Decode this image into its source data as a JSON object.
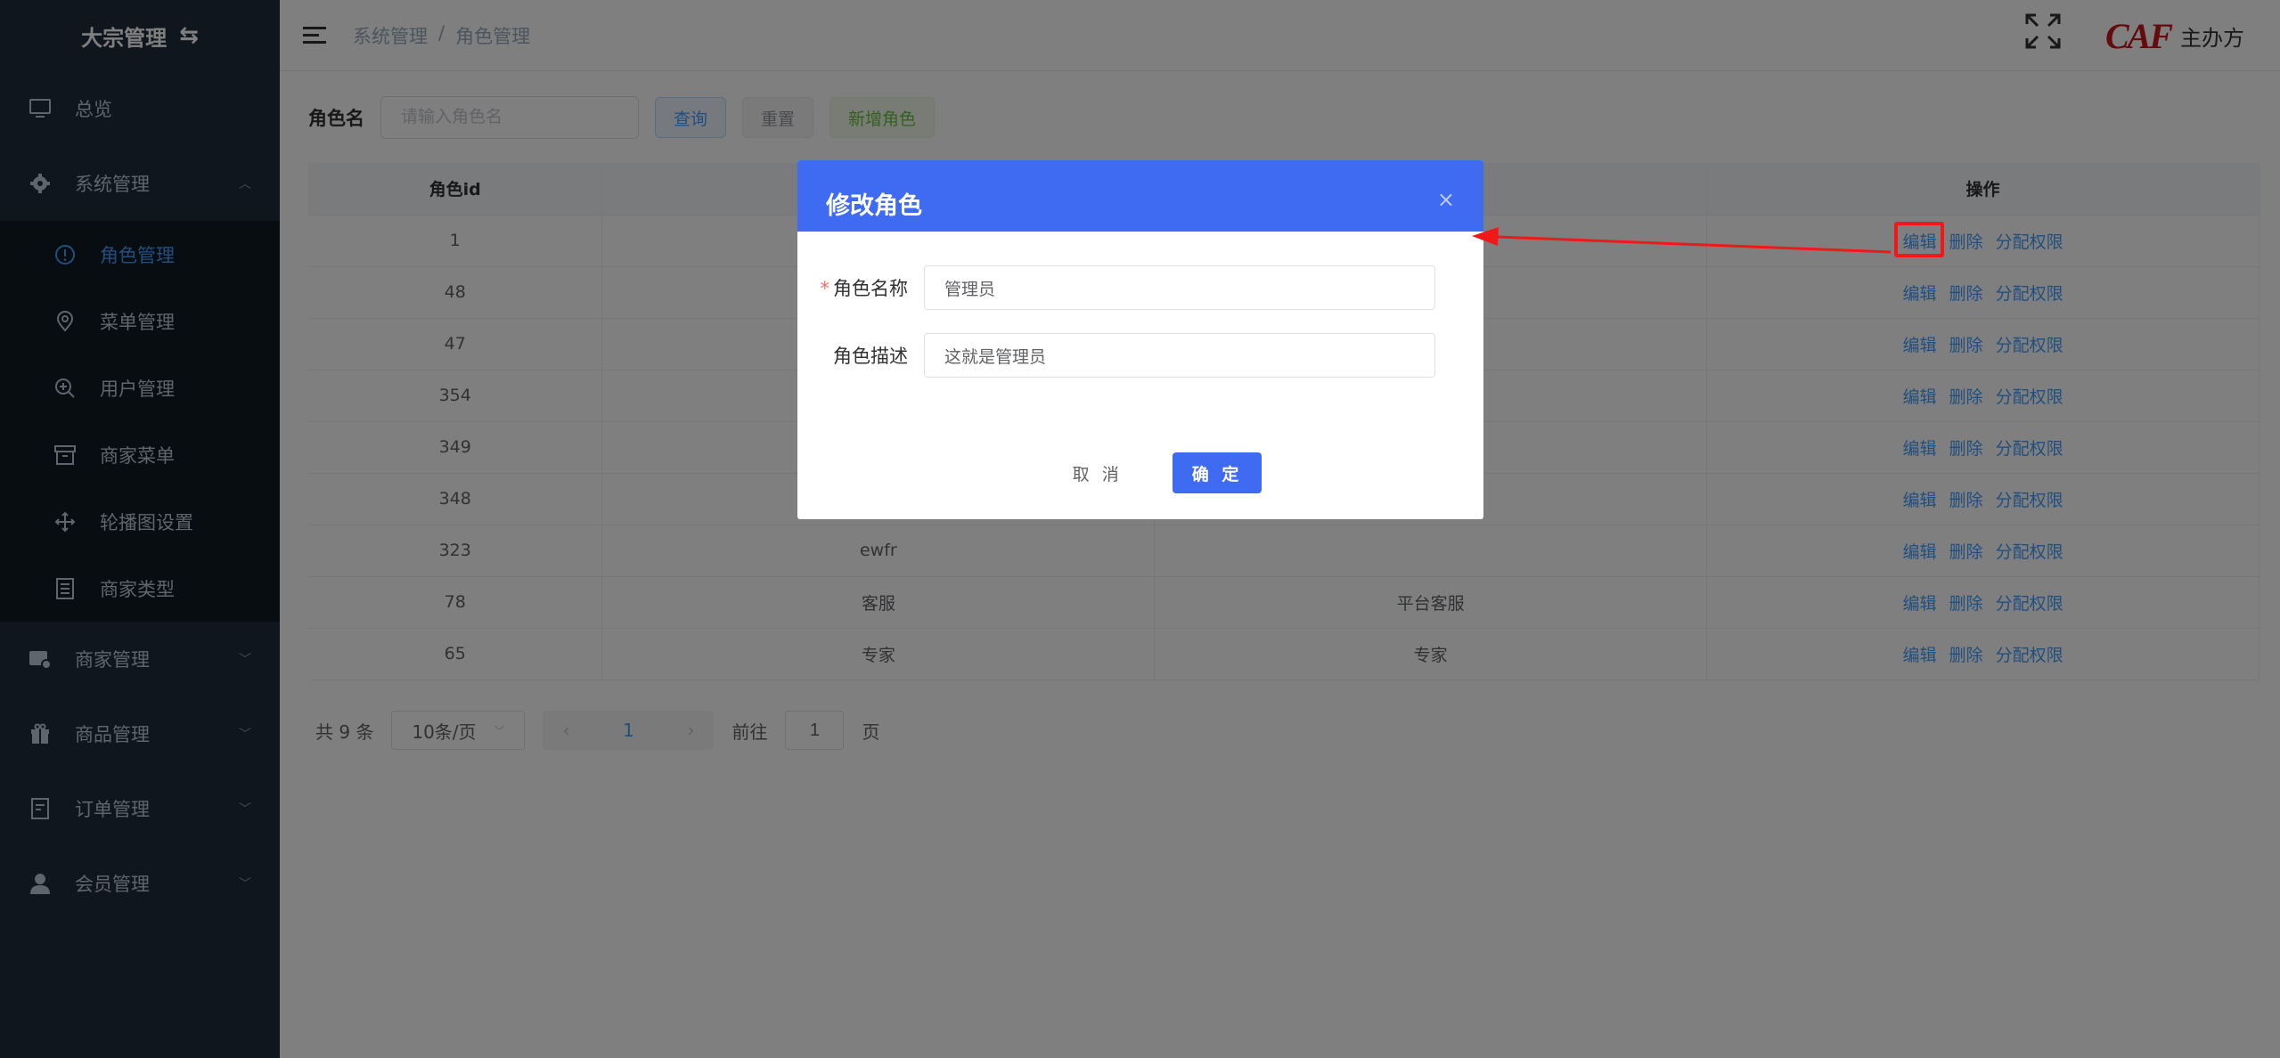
{
  "sidebar": {
    "title": "大宗管理",
    "swap_icon": "⇆",
    "items": [
      {
        "label": "总览",
        "icon": "monitor-icon"
      },
      {
        "label": "系统管理",
        "icon": "gear-icon",
        "expanded": true,
        "children": [
          {
            "label": "角色管理",
            "icon": "info-circle-icon",
            "active": true
          },
          {
            "label": "菜单管理",
            "icon": "location-icon"
          },
          {
            "label": "用户管理",
            "icon": "zoom-in-icon"
          },
          {
            "label": "商家菜单",
            "icon": "box-icon"
          },
          {
            "label": "轮播图设置",
            "icon": "rank-icon"
          },
          {
            "label": "商家类型",
            "icon": "document-icon"
          }
        ]
      },
      {
        "label": "商家管理",
        "icon": "store-icon"
      },
      {
        "label": "商品管理",
        "icon": "gift-icon"
      },
      {
        "label": "订单管理",
        "icon": "order-icon"
      },
      {
        "label": "会员管理",
        "icon": "user-icon"
      }
    ]
  },
  "header": {
    "breadcrumb": [
      "系统管理",
      "角色管理"
    ],
    "separator": "/",
    "org_logo": "CAF",
    "org_label": "主办方"
  },
  "search": {
    "label": "角色名",
    "placeholder": "请输入角色名",
    "query_label": "查询",
    "reset_label": "重置",
    "add_label": "新增角色"
  },
  "table": {
    "columns": [
      "角色id",
      "",
      "",
      "操作"
    ],
    "rows": [
      {
        "id": "1",
        "name": "",
        "desc": ""
      },
      {
        "id": "48",
        "name": "",
        "desc": ""
      },
      {
        "id": "47",
        "name": "",
        "desc": ""
      },
      {
        "id": "354",
        "name": "",
        "desc": ""
      },
      {
        "id": "349",
        "name": "",
        "desc": ""
      },
      {
        "id": "348",
        "name": "",
        "desc": ""
      },
      {
        "id": "323",
        "name": "ewfr",
        "desc": ""
      },
      {
        "id": "78",
        "name": "客服",
        "desc": "平台客服"
      },
      {
        "id": "65",
        "name": "专家",
        "desc": "专家"
      }
    ],
    "ops": {
      "edit": "编辑",
      "delete": "删除",
      "assign": "分配权限"
    }
  },
  "pager": {
    "total": "共 9 条",
    "size": "10条/页",
    "current": "1",
    "goto_prefix": "前往",
    "goto_value": "1",
    "goto_suffix": "页"
  },
  "dialog": {
    "title": "修改角色",
    "close": "×",
    "name_label": "角色名称",
    "name_value": "管理员",
    "desc_label": "角色描述",
    "desc_value": "这就是管理员",
    "cancel": "取 消",
    "ok": "确 定"
  },
  "colors": {
    "sidebar_bg": "#1f2d3d",
    "primary": "#3e6bf2",
    "link": "#409eff",
    "annotation": "#f01818"
  }
}
